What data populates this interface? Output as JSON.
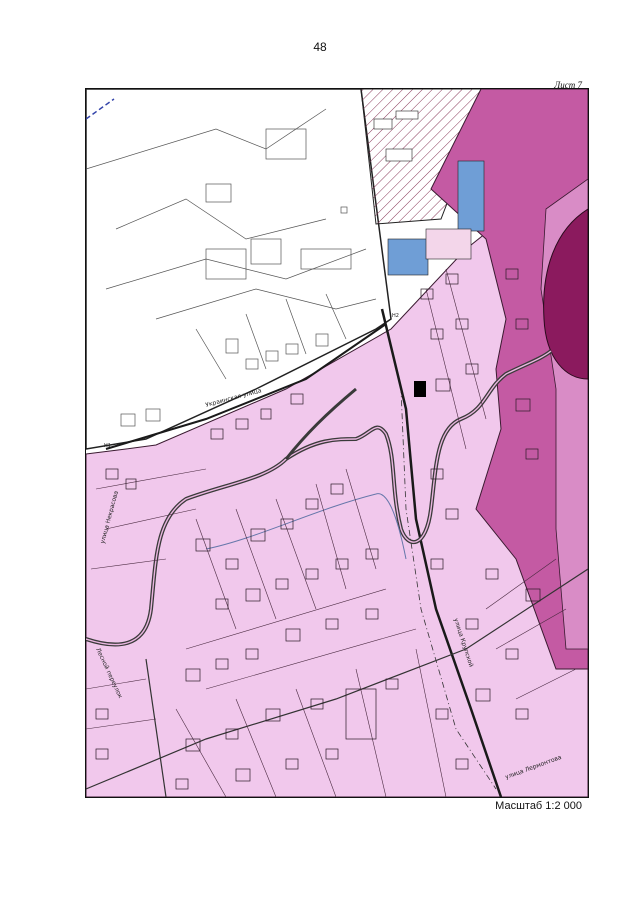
{
  "page": {
    "number": "48",
    "sheet": "Лист 7"
  },
  "map": {
    "scale": "Масштаб 1:2 000",
    "streets": [
      {
        "id": "ukrainskaya",
        "label": "Украинская улица"
      },
      {
        "id": "left-street",
        "label": "улица Некрасова"
      },
      {
        "id": "left-lane",
        "label": "Лесной переулок"
      },
      {
        "id": "lower-street",
        "label": "улица Лермонтова"
      },
      {
        "id": "main-road",
        "label": "улица Крупской"
      }
    ],
    "points": [
      {
        "id": "pt-1",
        "label": "Н2"
      },
      {
        "id": "pt-2",
        "label": "Н1"
      }
    ],
    "colors": {
      "residential": "#f1c8ec",
      "zone_dark": "#c45aa3",
      "zone_core": "#8b1a5e",
      "zone_mid": "#d98cc6",
      "blue_area": "#6f9ed6",
      "hatch": "#8a3a5a",
      "outline": "#222222"
    }
  }
}
